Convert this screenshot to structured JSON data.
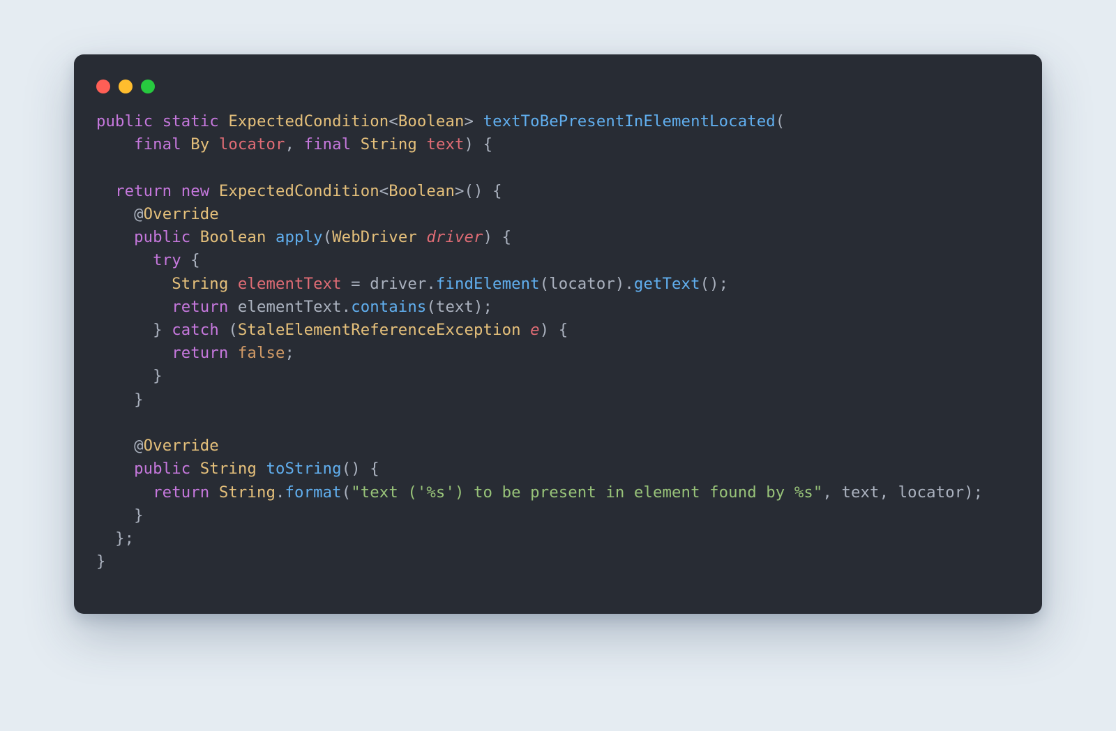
{
  "colors": {
    "bg": "#e5ecf2",
    "window": "#282c34",
    "text": "#abb2bf",
    "keyword": "#c678dd",
    "type": "#e5c07b",
    "func": "#61afef",
    "var": "#e06c75",
    "string": "#98c379",
    "literal": "#d19a66"
  },
  "traffic": [
    "close",
    "minimize",
    "zoom"
  ],
  "code": {
    "tokens": [
      [
        [
          "kw",
          "public"
        ],
        [
          "sp",
          " "
        ],
        [
          "kw",
          "static"
        ],
        [
          "sp",
          " "
        ],
        [
          "type",
          "ExpectedCondition"
        ],
        [
          "pun",
          "<"
        ],
        [
          "type",
          "Boolean"
        ],
        [
          "pun",
          "> "
        ],
        [
          "fn",
          "textToBePresentInElementLocated"
        ],
        [
          "pun",
          "("
        ]
      ],
      [
        [
          "sp",
          "    "
        ],
        [
          "kw",
          "final"
        ],
        [
          "sp",
          " "
        ],
        [
          "type",
          "By"
        ],
        [
          "sp",
          " "
        ],
        [
          "var",
          "locator"
        ],
        [
          "pun",
          ", "
        ],
        [
          "kw",
          "final"
        ],
        [
          "sp",
          " "
        ],
        [
          "type",
          "String"
        ],
        [
          "sp",
          " "
        ],
        [
          "var",
          "text"
        ],
        [
          "pun",
          ") {"
        ]
      ],
      [],
      [
        [
          "sp",
          "  "
        ],
        [
          "kw",
          "return"
        ],
        [
          "sp",
          " "
        ],
        [
          "kw",
          "new"
        ],
        [
          "sp",
          " "
        ],
        [
          "type",
          "ExpectedCondition"
        ],
        [
          "pun",
          "<"
        ],
        [
          "type",
          "Boolean"
        ],
        [
          "pun",
          ">() {"
        ]
      ],
      [
        [
          "sp",
          "    "
        ],
        [
          "pun",
          "@"
        ],
        [
          "ann",
          "Override"
        ]
      ],
      [
        [
          "sp",
          "    "
        ],
        [
          "kw",
          "public"
        ],
        [
          "sp",
          " "
        ],
        [
          "type",
          "Boolean"
        ],
        [
          "sp",
          " "
        ],
        [
          "fn",
          "apply"
        ],
        [
          "pun",
          "("
        ],
        [
          "type",
          "WebDriver"
        ],
        [
          "sp",
          " "
        ],
        [
          "em",
          "driver"
        ],
        [
          "pun",
          ") {"
        ]
      ],
      [
        [
          "sp",
          "      "
        ],
        [
          "kw",
          "try"
        ],
        [
          "pun",
          " {"
        ]
      ],
      [
        [
          "sp",
          "        "
        ],
        [
          "type",
          "String"
        ],
        [
          "sp",
          " "
        ],
        [
          "var",
          "elementText"
        ],
        [
          "pun",
          " = driver."
        ],
        [
          "fn",
          "findElement"
        ],
        [
          "pun",
          "(locator)."
        ],
        [
          "fn",
          "getText"
        ],
        [
          "pun",
          "();"
        ]
      ],
      [
        [
          "sp",
          "        "
        ],
        [
          "kw",
          "return"
        ],
        [
          "sp",
          " "
        ],
        [
          "pun",
          "elementText."
        ],
        [
          "fn",
          "contains"
        ],
        [
          "pun",
          "(text);"
        ]
      ],
      [
        [
          "sp",
          "      "
        ],
        [
          "pun",
          "} "
        ],
        [
          "kw",
          "catch"
        ],
        [
          "pun",
          " ("
        ],
        [
          "type",
          "StaleElementReferenceException"
        ],
        [
          "sp",
          " "
        ],
        [
          "em",
          "e"
        ],
        [
          "pun",
          ") {"
        ]
      ],
      [
        [
          "sp",
          "        "
        ],
        [
          "kw",
          "return"
        ],
        [
          "sp",
          " "
        ],
        [
          "k2",
          "false"
        ],
        [
          "pun",
          ";"
        ]
      ],
      [
        [
          "sp",
          "      "
        ],
        [
          "pun",
          "}"
        ]
      ],
      [
        [
          "sp",
          "    "
        ],
        [
          "pun",
          "}"
        ]
      ],
      [],
      [
        [
          "sp",
          "    "
        ],
        [
          "pun",
          "@"
        ],
        [
          "ann",
          "Override"
        ]
      ],
      [
        [
          "sp",
          "    "
        ],
        [
          "kw",
          "public"
        ],
        [
          "sp",
          " "
        ],
        [
          "type",
          "String"
        ],
        [
          "sp",
          " "
        ],
        [
          "fn",
          "toString"
        ],
        [
          "pun",
          "() {"
        ]
      ],
      [
        [
          "sp",
          "      "
        ],
        [
          "kw",
          "return"
        ],
        [
          "sp",
          " "
        ],
        [
          "type",
          "String"
        ],
        [
          "pun",
          "."
        ],
        [
          "fn",
          "format"
        ],
        [
          "pun",
          "("
        ],
        [
          "str",
          "\"text ('%s') to be present in element found by %s\""
        ],
        [
          "pun",
          ", text, locator);"
        ]
      ],
      [
        [
          "sp",
          "    "
        ],
        [
          "pun",
          "}"
        ]
      ],
      [
        [
          "sp",
          "  "
        ],
        [
          "pun",
          "};"
        ]
      ],
      [
        [
          "pun",
          "}"
        ]
      ]
    ]
  }
}
